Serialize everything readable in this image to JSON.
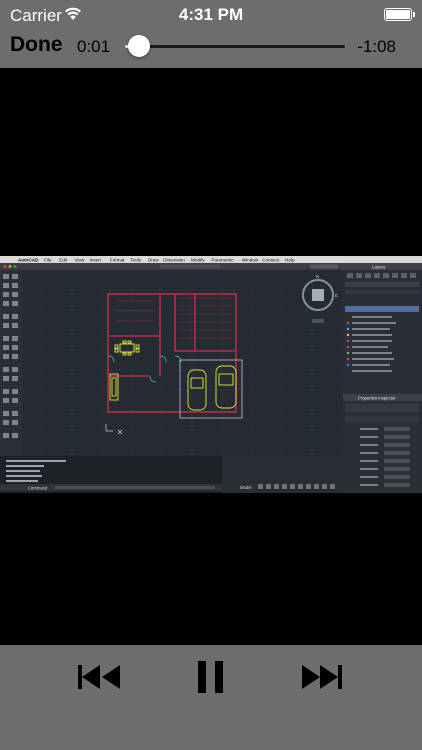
{
  "status_bar": {
    "carrier": "Carrier",
    "time": "4:31 PM",
    "battery_level": 1.0
  },
  "player": {
    "done_label": "Done",
    "elapsed": "0:01",
    "remaining": "-1:08",
    "progress": 0.02
  },
  "video_frame": {
    "app_name": "AutoCAD",
    "menu_items": [
      "File",
      "Edit",
      "View",
      "Insert",
      "Format",
      "Tools",
      "Draw",
      "Dimension",
      "Modify",
      "Parametric",
      "Window",
      "Connect",
      "Help"
    ],
    "panels": [
      "Layers",
      "Properties Inspector"
    ],
    "command_label": "Command",
    "model_tab": "Model"
  },
  "controls": {
    "previous": "skip-back",
    "pause": "pause",
    "next": "skip-forward"
  },
  "colors": {
    "bar_background": "#6d6d6d",
    "video_background": "#2a2d33"
  }
}
